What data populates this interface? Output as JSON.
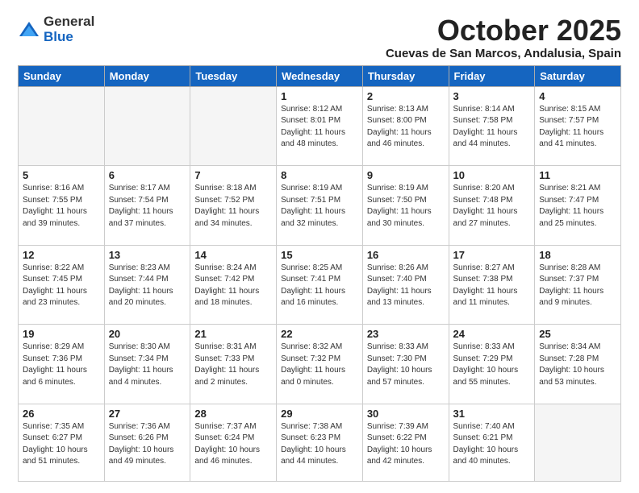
{
  "logo": {
    "general": "General",
    "blue": "Blue"
  },
  "title": {
    "month": "October 2025",
    "location": "Cuevas de San Marcos, Andalusia, Spain"
  },
  "headers": [
    "Sunday",
    "Monday",
    "Tuesday",
    "Wednesday",
    "Thursday",
    "Friday",
    "Saturday"
  ],
  "weeks": [
    [
      {
        "day": "",
        "info": ""
      },
      {
        "day": "",
        "info": ""
      },
      {
        "day": "",
        "info": ""
      },
      {
        "day": "1",
        "info": "Sunrise: 8:12 AM\nSunset: 8:01 PM\nDaylight: 11 hours\nand 48 minutes."
      },
      {
        "day": "2",
        "info": "Sunrise: 8:13 AM\nSunset: 8:00 PM\nDaylight: 11 hours\nand 46 minutes."
      },
      {
        "day": "3",
        "info": "Sunrise: 8:14 AM\nSunset: 7:58 PM\nDaylight: 11 hours\nand 44 minutes."
      },
      {
        "day": "4",
        "info": "Sunrise: 8:15 AM\nSunset: 7:57 PM\nDaylight: 11 hours\nand 41 minutes."
      }
    ],
    [
      {
        "day": "5",
        "info": "Sunrise: 8:16 AM\nSunset: 7:55 PM\nDaylight: 11 hours\nand 39 minutes."
      },
      {
        "day": "6",
        "info": "Sunrise: 8:17 AM\nSunset: 7:54 PM\nDaylight: 11 hours\nand 37 minutes."
      },
      {
        "day": "7",
        "info": "Sunrise: 8:18 AM\nSunset: 7:52 PM\nDaylight: 11 hours\nand 34 minutes."
      },
      {
        "day": "8",
        "info": "Sunrise: 8:19 AM\nSunset: 7:51 PM\nDaylight: 11 hours\nand 32 minutes."
      },
      {
        "day": "9",
        "info": "Sunrise: 8:19 AM\nSunset: 7:50 PM\nDaylight: 11 hours\nand 30 minutes."
      },
      {
        "day": "10",
        "info": "Sunrise: 8:20 AM\nSunset: 7:48 PM\nDaylight: 11 hours\nand 27 minutes."
      },
      {
        "day": "11",
        "info": "Sunrise: 8:21 AM\nSunset: 7:47 PM\nDaylight: 11 hours\nand 25 minutes."
      }
    ],
    [
      {
        "day": "12",
        "info": "Sunrise: 8:22 AM\nSunset: 7:45 PM\nDaylight: 11 hours\nand 23 minutes."
      },
      {
        "day": "13",
        "info": "Sunrise: 8:23 AM\nSunset: 7:44 PM\nDaylight: 11 hours\nand 20 minutes."
      },
      {
        "day": "14",
        "info": "Sunrise: 8:24 AM\nSunset: 7:42 PM\nDaylight: 11 hours\nand 18 minutes."
      },
      {
        "day": "15",
        "info": "Sunrise: 8:25 AM\nSunset: 7:41 PM\nDaylight: 11 hours\nand 16 minutes."
      },
      {
        "day": "16",
        "info": "Sunrise: 8:26 AM\nSunset: 7:40 PM\nDaylight: 11 hours\nand 13 minutes."
      },
      {
        "day": "17",
        "info": "Sunrise: 8:27 AM\nSunset: 7:38 PM\nDaylight: 11 hours\nand 11 minutes."
      },
      {
        "day": "18",
        "info": "Sunrise: 8:28 AM\nSunset: 7:37 PM\nDaylight: 11 hours\nand 9 minutes."
      }
    ],
    [
      {
        "day": "19",
        "info": "Sunrise: 8:29 AM\nSunset: 7:36 PM\nDaylight: 11 hours\nand 6 minutes."
      },
      {
        "day": "20",
        "info": "Sunrise: 8:30 AM\nSunset: 7:34 PM\nDaylight: 11 hours\nand 4 minutes."
      },
      {
        "day": "21",
        "info": "Sunrise: 8:31 AM\nSunset: 7:33 PM\nDaylight: 11 hours\nand 2 minutes."
      },
      {
        "day": "22",
        "info": "Sunrise: 8:32 AM\nSunset: 7:32 PM\nDaylight: 11 hours\nand 0 minutes."
      },
      {
        "day": "23",
        "info": "Sunrise: 8:33 AM\nSunset: 7:30 PM\nDaylight: 10 hours\nand 57 minutes."
      },
      {
        "day": "24",
        "info": "Sunrise: 8:33 AM\nSunset: 7:29 PM\nDaylight: 10 hours\nand 55 minutes."
      },
      {
        "day": "25",
        "info": "Sunrise: 8:34 AM\nSunset: 7:28 PM\nDaylight: 10 hours\nand 53 minutes."
      }
    ],
    [
      {
        "day": "26",
        "info": "Sunrise: 7:35 AM\nSunset: 6:27 PM\nDaylight: 10 hours\nand 51 minutes."
      },
      {
        "day": "27",
        "info": "Sunrise: 7:36 AM\nSunset: 6:26 PM\nDaylight: 10 hours\nand 49 minutes."
      },
      {
        "day": "28",
        "info": "Sunrise: 7:37 AM\nSunset: 6:24 PM\nDaylight: 10 hours\nand 46 minutes."
      },
      {
        "day": "29",
        "info": "Sunrise: 7:38 AM\nSunset: 6:23 PM\nDaylight: 10 hours\nand 44 minutes."
      },
      {
        "day": "30",
        "info": "Sunrise: 7:39 AM\nSunset: 6:22 PM\nDaylight: 10 hours\nand 42 minutes."
      },
      {
        "day": "31",
        "info": "Sunrise: 7:40 AM\nSunset: 6:21 PM\nDaylight: 10 hours\nand 40 minutes."
      },
      {
        "day": "",
        "info": ""
      }
    ]
  ]
}
